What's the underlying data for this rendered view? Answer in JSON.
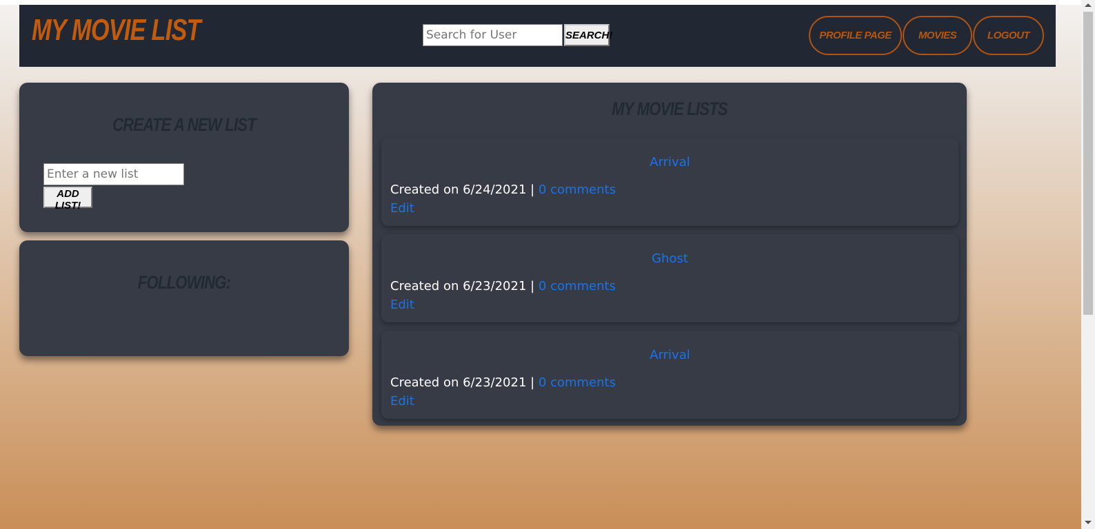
{
  "header": {
    "brand": "My Movie List",
    "search_placeholder": "Search for User",
    "search_button": "Search!",
    "nav": [
      "Profile Page",
      "Movies",
      "Logout"
    ]
  },
  "create_list": {
    "heading": "Create A New List",
    "input_placeholder": "Enter a new list",
    "add_button": "Add List!"
  },
  "following": {
    "heading": "Following:"
  },
  "movie_lists": {
    "heading": "My Movie Lists",
    "items": [
      {
        "title": "Arrival",
        "created": "Created on 6/24/2021 | ",
        "comments": "0 comments",
        "edit": "Edit"
      },
      {
        "title": "Ghost",
        "created": "Created on 6/23/2021 | ",
        "comments": "0 comments",
        "edit": "Edit"
      },
      {
        "title": "Arrival",
        "created": "Created on 6/23/2021 | ",
        "comments": "0 comments",
        "edit": "Edit"
      }
    ]
  },
  "colors": {
    "brand": "#c15b0e",
    "navbar": "#212834",
    "card": "#363b45",
    "link": "#1a73e8"
  }
}
